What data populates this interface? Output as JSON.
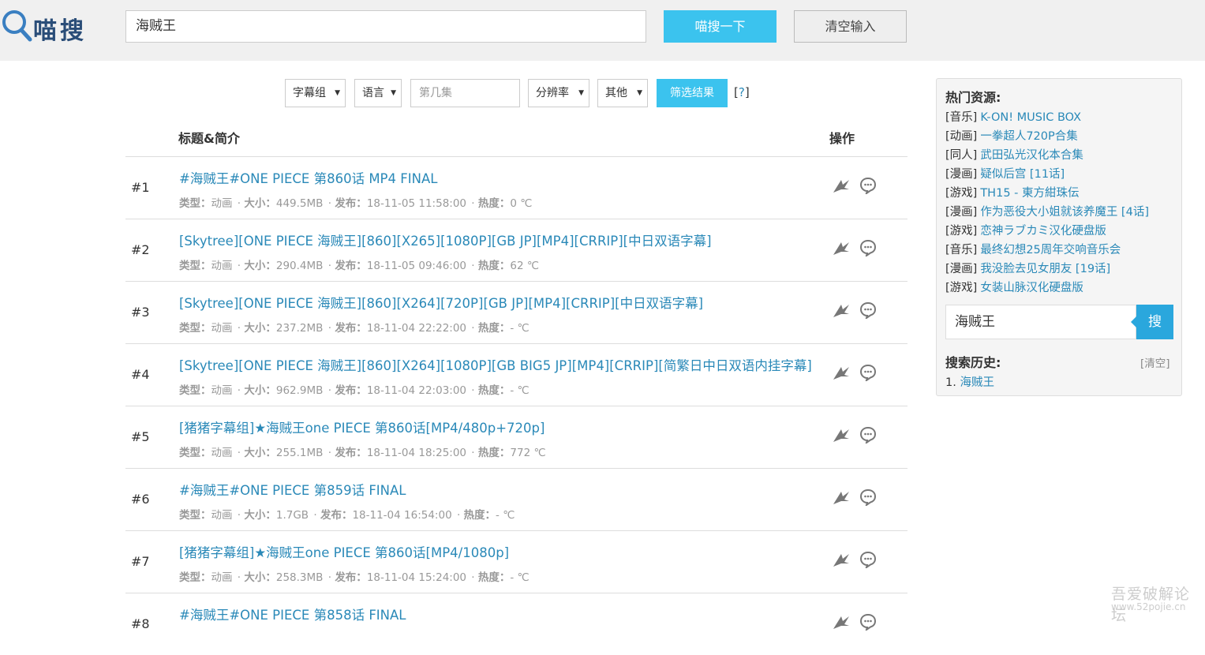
{
  "header": {
    "logo_text": "喵搜",
    "search_value": "海贼王",
    "search_button": "喵搜一下",
    "clear_button": "清空输入"
  },
  "filters": {
    "subgroup": "字幕组",
    "language": "语言",
    "episode_placeholder": "第几集",
    "resolution": "分辨率",
    "other": "其他",
    "apply_button": "筛选结果",
    "help_open": "[",
    "help_mark": "?",
    "help_close": "]"
  },
  "table": {
    "col_title": "标题&简介",
    "col_ops": "操作",
    "labels": {
      "type": "类型：",
      "size": "大小：",
      "date": "发布：",
      "heat": "热度："
    },
    "rows": [
      {
        "num": "#1",
        "title": "#海贼王#ONE PIECE 第860话 MP4 FINAL",
        "type": "动画",
        "size": "449.5MB",
        "date": "18-11-05 11:58:00",
        "heat": "0 ℃"
      },
      {
        "num": "#2",
        "title": "[Skytree][ONE PIECE 海贼王][860][X265][1080P][GB JP][MP4][CRRIP][中日双语字幕]",
        "type": "动画",
        "size": "290.4MB",
        "date": "18-11-05 09:46:00",
        "heat": "62 ℃"
      },
      {
        "num": "#3",
        "title": "[Skytree][ONE PIECE 海贼王][860][X264][720P][GB JP][MP4][CRRIP][中日双语字幕]",
        "type": "动画",
        "size": "237.2MB",
        "date": "18-11-04 22:22:00",
        "heat": "- ℃"
      },
      {
        "num": "#4",
        "title": "[Skytree][ONE PIECE 海贼王][860][X264][1080P][GB BIG5 JP][MP4][CRRIP][简繁日中日双语内挂字幕]",
        "type": "动画",
        "size": "962.9MB",
        "date": "18-11-04 22:03:00",
        "heat": "- ℃"
      },
      {
        "num": "#5",
        "title": "[猪猪字幕组]★海贼王one PIECE 第860话[MP4/480p+720p]",
        "type": "动画",
        "size": "255.1MB",
        "date": "18-11-04 18:25:00",
        "heat": "772 ℃"
      },
      {
        "num": "#6",
        "title": "#海贼王#ONE PIECE 第859话 FINAL",
        "type": "动画",
        "size": "1.7GB",
        "date": "18-11-04 16:54:00",
        "heat": "- ℃"
      },
      {
        "num": "#7",
        "title": "[猪猪字幕组]★海贼王one PIECE 第860话[MP4/1080p]",
        "type": "动画",
        "size": "258.3MB",
        "date": "18-11-04 15:24:00",
        "heat": "- ℃"
      },
      {
        "num": "#8",
        "title": "#海贼王#ONE PIECE 第858话 FINAL",
        "type": "",
        "size": "",
        "date": "",
        "heat": ""
      }
    ]
  },
  "sidebar": {
    "hot_heading": "热门资源:",
    "hot_items": [
      {
        "cat": "[音乐]",
        "name": "K-ON! MUSIC BOX"
      },
      {
        "cat": "[动画]",
        "name": "一拳超人720P合集"
      },
      {
        "cat": "[同人]",
        "name": "武田弘光汉化本合集"
      },
      {
        "cat": "[漫画]",
        "name": "疑似后宫 [11话]"
      },
      {
        "cat": "[游戏]",
        "name": "TH15 - 東方紺珠伝"
      },
      {
        "cat": "[漫画]",
        "name": "作为恶役大小姐就该养魔王 [4话]"
      },
      {
        "cat": "[游戏]",
        "name": "恋神ラブカミ汉化硬盘版"
      },
      {
        "cat": "[音乐]",
        "name": "最终幻想25周年交响音乐会"
      },
      {
        "cat": "[漫画]",
        "name": "我没脸去见女朋友 [19话]"
      },
      {
        "cat": "[游戏]",
        "name": "女装山脉汉化硬盘版"
      }
    ],
    "search_value": "海贼王",
    "search_button": "搜",
    "history_heading": "搜索历史:",
    "history_clear": "[清空]",
    "history_items": [
      {
        "num": "1.",
        "term": "海贼王"
      }
    ]
  },
  "watermark": {
    "line1": "吾爱破解论坛",
    "line2": "www.52pojie.cn"
  },
  "colors": {
    "accent": "#3bc3ee",
    "link": "#2a89b8",
    "header_bg": "#f0f0f0"
  },
  "icons": {
    "download": "bird-download-icon",
    "comment": "speech-bubble-icon",
    "logo": "magnifier-logo-icon"
  }
}
